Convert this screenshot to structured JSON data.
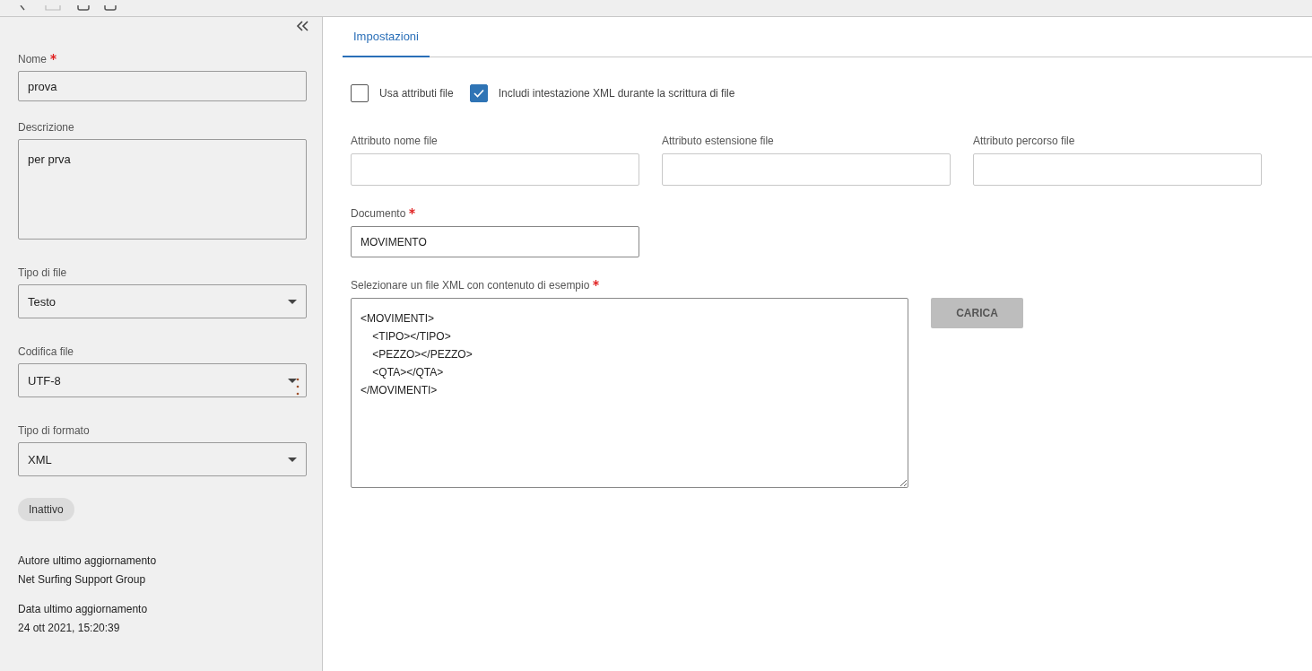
{
  "sidebar": {
    "fields": [
      {
        "kind": "text",
        "label": "Nome",
        "required": true,
        "value": "prova"
      },
      {
        "kind": "textarea",
        "label": "Descrizione",
        "required": false,
        "value": "per prva"
      },
      {
        "kind": "select",
        "label": "Tipo di file",
        "required": false,
        "value": "Testo"
      },
      {
        "kind": "select",
        "label": "Codifica file",
        "required": false,
        "value": "UTF-8"
      },
      {
        "kind": "select",
        "label": "Tipo di formato",
        "required": false,
        "value": "XML"
      }
    ],
    "status_badge": "Inattivo",
    "meta": [
      {
        "label": "Autore ultimo aggiornamento",
        "value": "Net Surfing Support Group"
      },
      {
        "label": "Data ultimo aggiornamento",
        "value": "24 ott 2021, 15:20:39"
      }
    ]
  },
  "tabs": [
    {
      "label": "Impostazioni",
      "selected": true
    }
  ],
  "checkboxes": [
    {
      "label": "Usa attributi file",
      "checked": false
    },
    {
      "label": "Includi intestazione XML durante la scrittura di file",
      "checked": true
    }
  ],
  "attribute_fields": [
    {
      "label": "Attributo nome file"
    },
    {
      "label": "Attributo estensione file"
    },
    {
      "label": "Attributo percorso file"
    }
  ],
  "document_field": {
    "label": "Documento",
    "required": true,
    "value": "MOVIMENTO"
  },
  "sample_xml": {
    "label": "Selezionare un file XML con contenuto di esempio",
    "required": true,
    "value": "<MOVIMENTI>\n\t<TIPO></TIPO>\n\t<PEZZO></PEZZO>\n\t<QTA></QTA>\n</MOVIMENTI>"
  },
  "load_button": {
    "label": "CARICA",
    "disabled": true
  }
}
